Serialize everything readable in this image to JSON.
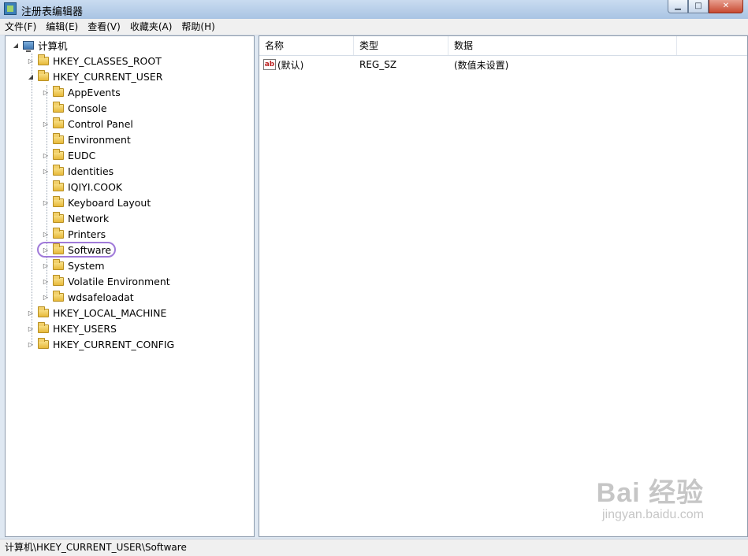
{
  "window": {
    "title": "注册表编辑器",
    "controls": {
      "minimize": "▁",
      "maximize": "□",
      "close": "✕"
    }
  },
  "menu": [
    "文件(F)",
    "编辑(E)",
    "查看(V)",
    "收藏夹(A)",
    "帮助(H)"
  ],
  "tree": {
    "root": "计算机",
    "nodes": [
      {
        "label": "HKEY_CLASSES_ROOT",
        "expander": "▷"
      },
      {
        "label": "HKEY_CURRENT_USER",
        "expander": "◢"
      },
      {
        "label": "AppEvents",
        "expander": "▷"
      },
      {
        "label": "Console",
        "expander": ""
      },
      {
        "label": "Control Panel",
        "expander": "▷"
      },
      {
        "label": "Environment",
        "expander": ""
      },
      {
        "label": "EUDC",
        "expander": "▷"
      },
      {
        "label": "Identities",
        "expander": "▷"
      },
      {
        "label": "IQIYI.COOK",
        "expander": ""
      },
      {
        "label": "Keyboard Layout",
        "expander": "▷"
      },
      {
        "label": "Network",
        "expander": ""
      },
      {
        "label": "Printers",
        "expander": "▷"
      },
      {
        "label": "Software",
        "expander": "▷"
      },
      {
        "label": "System",
        "expander": "▷"
      },
      {
        "label": "Volatile Environment",
        "expander": "▷"
      },
      {
        "label": "wdsafeloadat",
        "expander": "▷"
      },
      {
        "label": "HKEY_LOCAL_MACHINE",
        "expander": "▷"
      },
      {
        "label": "HKEY_USERS",
        "expander": "▷"
      },
      {
        "label": "HKEY_CURRENT_CONFIG",
        "expander": "▷"
      }
    ]
  },
  "list": {
    "columns": [
      "名称",
      "类型",
      "数据"
    ],
    "rows": [
      {
        "icon": "ab",
        "name": "(默认)",
        "type": "REG_SZ",
        "data": "(数值未设置)"
      }
    ]
  },
  "status": {
    "path": "计算机\\HKEY_CURRENT_USER\\Software"
  },
  "watermark": {
    "main": "Bai  经验",
    "sub": "jingyan.baidu.com"
  },
  "colors": {
    "selection_ring": "#a07ad9",
    "title_bar": "#a9c4e3"
  }
}
